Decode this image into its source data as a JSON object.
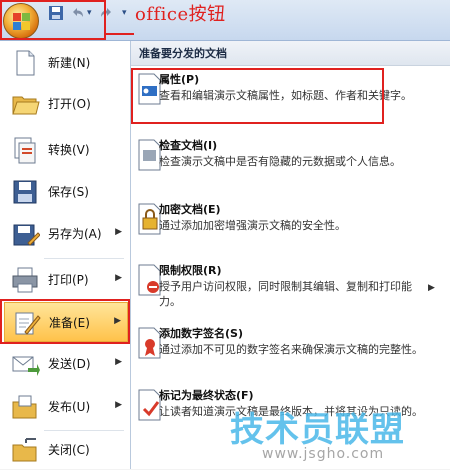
{
  "annotation": {
    "label": "office按钮",
    "color": "#e0211f"
  },
  "quick_access": {
    "undo_icon": "undo-icon",
    "redo_icon": "redo-icon",
    "save_icon": "save-icon",
    "dropdown_icon": "chevron-down-icon"
  },
  "left_menu": {
    "items": [
      {
        "label": "新建(N)",
        "icon": "new-document-icon"
      },
      {
        "label": "打开(O)",
        "icon": "open-folder-icon"
      },
      {
        "label": "转换(V)",
        "icon": "convert-icon"
      },
      {
        "label": "保存(S)",
        "icon": "save-icon"
      },
      {
        "label": "另存为(A)",
        "icon": "save-as-icon",
        "has_submenu": true
      },
      {
        "label": "打印(P)",
        "icon": "printer-icon",
        "has_submenu": true
      },
      {
        "label": "准备(E)",
        "icon": "prepare-icon",
        "has_submenu": true,
        "active": true
      },
      {
        "label": "发送(D)",
        "icon": "send-icon",
        "has_submenu": true
      },
      {
        "label": "发布(U)",
        "icon": "publish-icon",
        "has_submenu": true
      },
      {
        "label": "关闭(C)",
        "icon": "close-document-icon"
      }
    ]
  },
  "right_panel": {
    "header": "准备要分发的文档",
    "items": [
      {
        "title": "属性(P)",
        "desc": "查看和编辑演示文稿属性，如标题、作者和关键字。",
        "icon": "properties-icon",
        "highlight": true
      },
      {
        "title": "检查文档(I)",
        "desc": "检查演示文稿中是否有隐藏的元数据或个人信息。",
        "icon": "inspect-document-icon"
      },
      {
        "title": "加密文档(E)",
        "desc": "通过添加加密增强演示文稿的安全性。",
        "icon": "encrypt-lock-icon"
      },
      {
        "title": "限制权限(R)",
        "desc": "授予用户访问权限，同时限制其编辑、复制和打印能力。",
        "icon": "restrict-permission-icon",
        "has_submenu": true
      },
      {
        "title": "添加数字签名(S)",
        "desc": "通过添加不可见的数字签名来确保演示文稿的完整性。",
        "icon": "digital-signature-icon"
      },
      {
        "title": "标记为最终状态(F)",
        "desc": "让读者知道演示文稿是最终版本，并将其设为只读的。",
        "icon": "mark-final-icon"
      }
    ]
  },
  "watermark": {
    "text": "技术员联盟",
    "url": "www.jsgho.com"
  }
}
